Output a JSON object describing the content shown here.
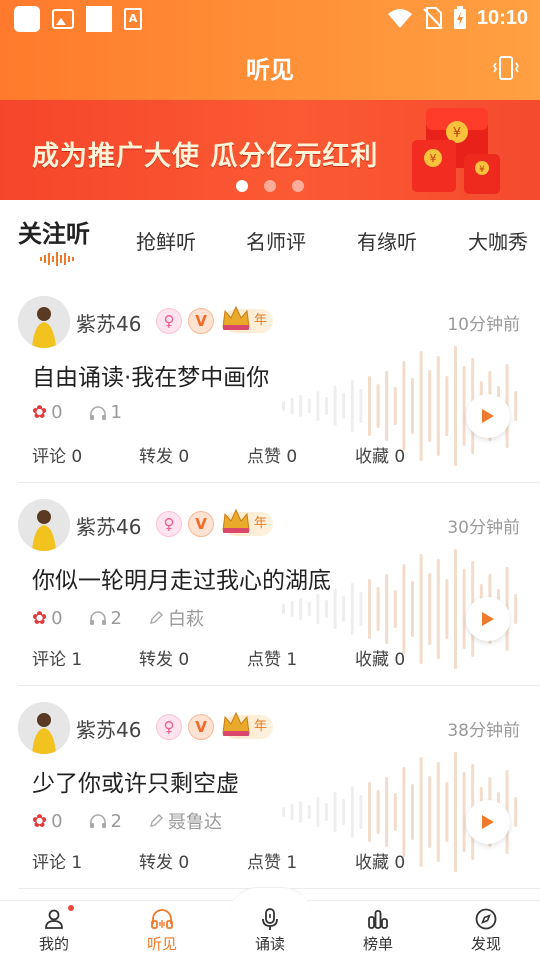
{
  "statusbar": {
    "time": "10:10"
  },
  "header": {
    "title": "听见"
  },
  "banner": {
    "text": "成为推广大使  瓜分亿元红利",
    "slides": 3,
    "active_slide": 1
  },
  "tabs": [
    {
      "label": "关注听",
      "active": true
    },
    {
      "label": "抢鲜听",
      "active": false
    },
    {
      "label": "名师评",
      "active": false
    },
    {
      "label": "有缘听",
      "active": false
    },
    {
      "label": "大咖秀",
      "active": false
    }
  ],
  "posts": [
    {
      "username": "紫苏46",
      "year_badge": "年",
      "time": "10分钟前",
      "title": "自由诵读·我在梦中画你",
      "flowers": "0",
      "listens": "1",
      "reviewer": "",
      "comments_label": "评论",
      "comments": "0",
      "shares_label": "转发",
      "shares": "0",
      "likes_label": "点赞",
      "likes": "0",
      "favs_label": "收藏",
      "favs": "0"
    },
    {
      "username": "紫苏46",
      "year_badge": "年",
      "time": "30分钟前",
      "title": "你似一轮明月走过我心的湖底",
      "flowers": "0",
      "listens": "2",
      "reviewer": "白萩",
      "comments_label": "评论",
      "comments": "1",
      "shares_label": "转发",
      "shares": "0",
      "likes_label": "点赞",
      "likes": "1",
      "favs_label": "收藏",
      "favs": "0"
    },
    {
      "username": "紫苏46",
      "year_badge": "年",
      "time": "38分钟前",
      "title": "少了你或许只剩空虚",
      "flowers": "0",
      "listens": "2",
      "reviewer": "聂鲁达",
      "comments_label": "评论",
      "comments": "1",
      "shares_label": "转发",
      "shares": "0",
      "likes_label": "点赞",
      "likes": "1",
      "favs_label": "收藏",
      "favs": "0"
    }
  ],
  "bottomnav": [
    {
      "label": "我的",
      "icon": "person-icon",
      "active": false,
      "dot": true
    },
    {
      "label": "听见",
      "icon": "headphones-icon",
      "active": true,
      "dot": false
    },
    {
      "label": "诵读",
      "icon": "microphone-icon",
      "active": false,
      "dot": false
    },
    {
      "label": "榜单",
      "icon": "ranking-icon",
      "active": false,
      "dot": false
    },
    {
      "label": "发现",
      "icon": "compass-icon",
      "active": false,
      "dot": false
    }
  ],
  "colors": {
    "accent": "#ff7a2c",
    "active_nav": "#f07a2b",
    "banner": "#f6452b"
  }
}
